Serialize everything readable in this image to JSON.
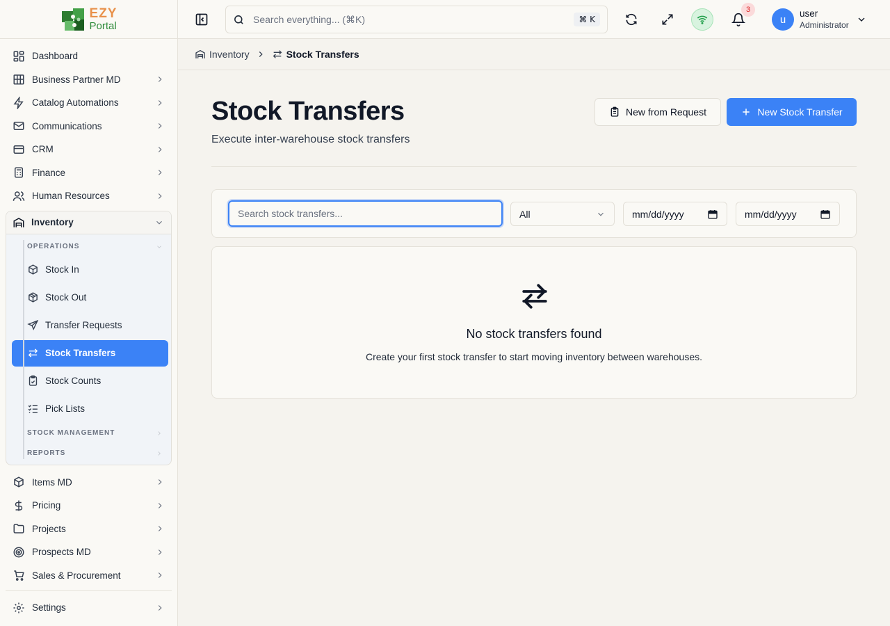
{
  "brand": {
    "name_top": "EZY",
    "name_bottom": "Portal"
  },
  "sidebar": {
    "items_top": [
      {
        "label": "Dashboard",
        "icon": "dashboard-icon"
      },
      {
        "label": "Business Partner MD",
        "icon": "building-icon"
      },
      {
        "label": "Catalog Automations",
        "icon": "zap-icon"
      },
      {
        "label": "Communications",
        "icon": "mail-icon"
      },
      {
        "label": "CRM",
        "icon": "card-icon"
      },
      {
        "label": "Finance",
        "icon": "calculator-icon"
      },
      {
        "label": "Human Resources",
        "icon": "users-icon"
      }
    ],
    "inventory": {
      "label": "Inventory",
      "sections": {
        "operations": "OPERATIONS",
        "stock_management": "STOCK MANAGEMENT",
        "reports": "REPORTS"
      },
      "operations_items": [
        {
          "label": "Stock In",
          "icon": "box-in-icon",
          "active": false
        },
        {
          "label": "Stock Out",
          "icon": "box-out-icon",
          "active": false
        },
        {
          "label": "Transfer Requests",
          "icon": "send-icon",
          "active": false
        },
        {
          "label": "Stock Transfers",
          "icon": "arrows-left-right-icon",
          "active": true
        },
        {
          "label": "Stock Counts",
          "icon": "clipboard-icon",
          "active": false
        },
        {
          "label": "Pick Lists",
          "icon": "list-checks-icon",
          "active": false
        }
      ]
    },
    "items_bottom": [
      {
        "label": "Items MD",
        "icon": "package-icon"
      },
      {
        "label": "Pricing",
        "icon": "dollar-icon"
      },
      {
        "label": "Projects",
        "icon": "folder-icon"
      },
      {
        "label": "Prospects MD",
        "icon": "target-icon"
      },
      {
        "label": "Sales & Procurement",
        "icon": "cart-icon"
      }
    ],
    "settings": {
      "label": "Settings",
      "icon": "gear-icon"
    }
  },
  "topbar": {
    "search_placeholder": "Search everything... (⌘K)",
    "search_shortcut": "⌘ K",
    "notification_count": "3",
    "user": {
      "initial": "u",
      "name": "user",
      "role": "Administrator"
    }
  },
  "breadcrumb": {
    "parent": "Inventory",
    "current": "Stock Transfers"
  },
  "page": {
    "title": "Stock Transfers",
    "subtitle": "Execute inter-warehouse stock transfers",
    "btn_from_request": "New from Request",
    "btn_new": "New Stock Transfer"
  },
  "filters": {
    "search_placeholder": "Search stock transfers...",
    "status_value": "All",
    "date_from": "mm/dd/yyyy",
    "date_to": "mm/dd/yyyy"
  },
  "empty_state": {
    "title": "No stock transfers found",
    "description": "Create your first stock transfer to start moving inventory between warehouses."
  },
  "colors": {
    "accent": "#3b82f6",
    "background": "#f5f3ee",
    "online": "#22a04b"
  }
}
